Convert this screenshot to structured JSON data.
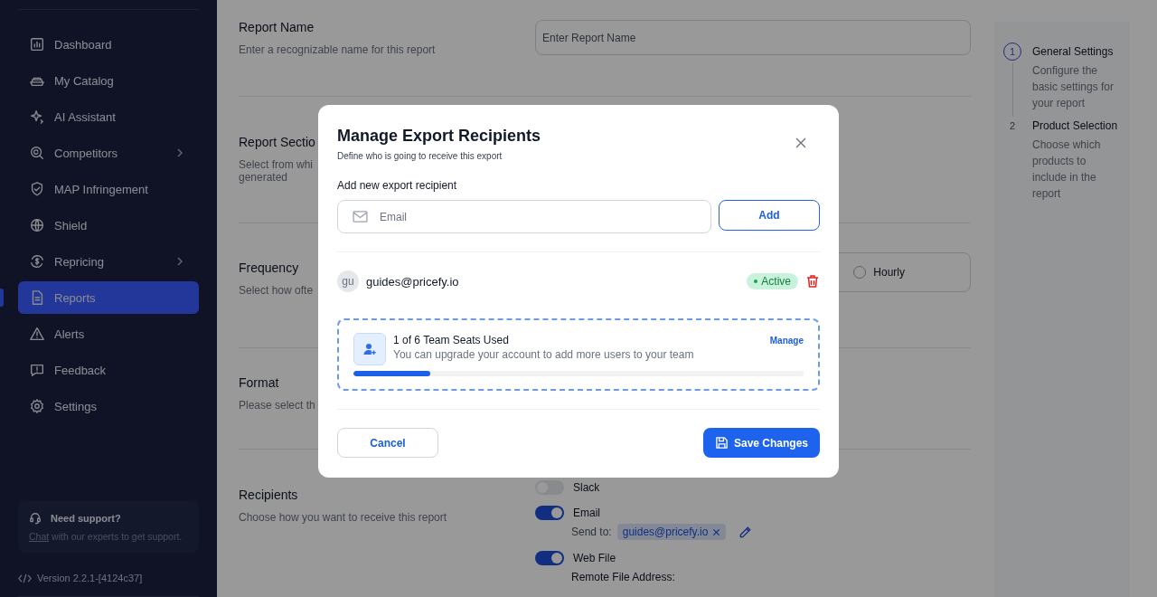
{
  "sidebar": {
    "items": [
      {
        "label": "Dashboard",
        "selected": false,
        "has_submenu": false
      },
      {
        "label": "My Catalog",
        "selected": false,
        "has_submenu": false
      },
      {
        "label": "AI Assistant",
        "selected": false,
        "has_submenu": false
      },
      {
        "label": "Competitors",
        "selected": false,
        "has_submenu": true
      },
      {
        "label": "MAP Infringement",
        "selected": false,
        "has_submenu": false
      },
      {
        "label": "Shield",
        "selected": false,
        "has_submenu": false
      },
      {
        "label": "Repricing",
        "selected": false,
        "has_submenu": true
      },
      {
        "label": "Reports",
        "selected": true,
        "has_submenu": false
      },
      {
        "label": "Alerts",
        "selected": false,
        "has_submenu": false
      },
      {
        "label": "Feedback",
        "selected": false,
        "has_submenu": false
      },
      {
        "label": "Settings",
        "selected": false,
        "has_submenu": false
      }
    ],
    "support": {
      "title": "Need support?",
      "link": "Chat",
      "text": "with our experts to get support."
    },
    "version": "Version 2.2.1-[4124c37]"
  },
  "form": {
    "report_name": {
      "title": "Report Name",
      "description": "Enter a recognizable name for this report",
      "placeholder": "Enter Report Name"
    },
    "report_sections": {
      "title": "Report Sectio",
      "description_lines": [
        "Select from whi",
        "generated"
      ]
    },
    "frequency": {
      "title": "Frequency",
      "description": "Select how ofte",
      "options": [
        {
          "label": "Hourly",
          "selected": false
        }
      ]
    },
    "format": {
      "title": "Format",
      "description": "Please select th"
    },
    "recipients": {
      "title": "Recipients",
      "description": "Choose how you want to receive this report",
      "channels": [
        {
          "label": "Slack",
          "on": false
        },
        {
          "label": "Email",
          "on": true,
          "send_to_label": "Send to:",
          "addresses": [
            "guides@pricefy.io"
          ]
        },
        {
          "label": "Web File",
          "on": true,
          "field_label": "Remote File Address:"
        }
      ]
    }
  },
  "stepper": {
    "steps": [
      {
        "number": "1",
        "title": "General Settings",
        "description": "Configure the basic settings for your report",
        "selected": true
      },
      {
        "number": "2",
        "title": "Product Selection",
        "description": "Choose which products to include in the report",
        "selected": false
      }
    ]
  },
  "modal": {
    "title": "Manage Export Recipients",
    "subtitle": "Define who is going to receive this export",
    "add_label": "Add new export recipient",
    "email_placeholder": "Email",
    "add_button": "Add",
    "recipients": [
      {
        "initials": "gu",
        "email": "guides@pricefy.io",
        "status": "Active"
      }
    ],
    "seats": {
      "title": "1 of 6 Team Seats Used",
      "text": "You can upgrade your account to add more users to your team",
      "link": "Manage",
      "level": 0.17
    },
    "cancel": "Cancel",
    "save": "Save Changes"
  }
}
